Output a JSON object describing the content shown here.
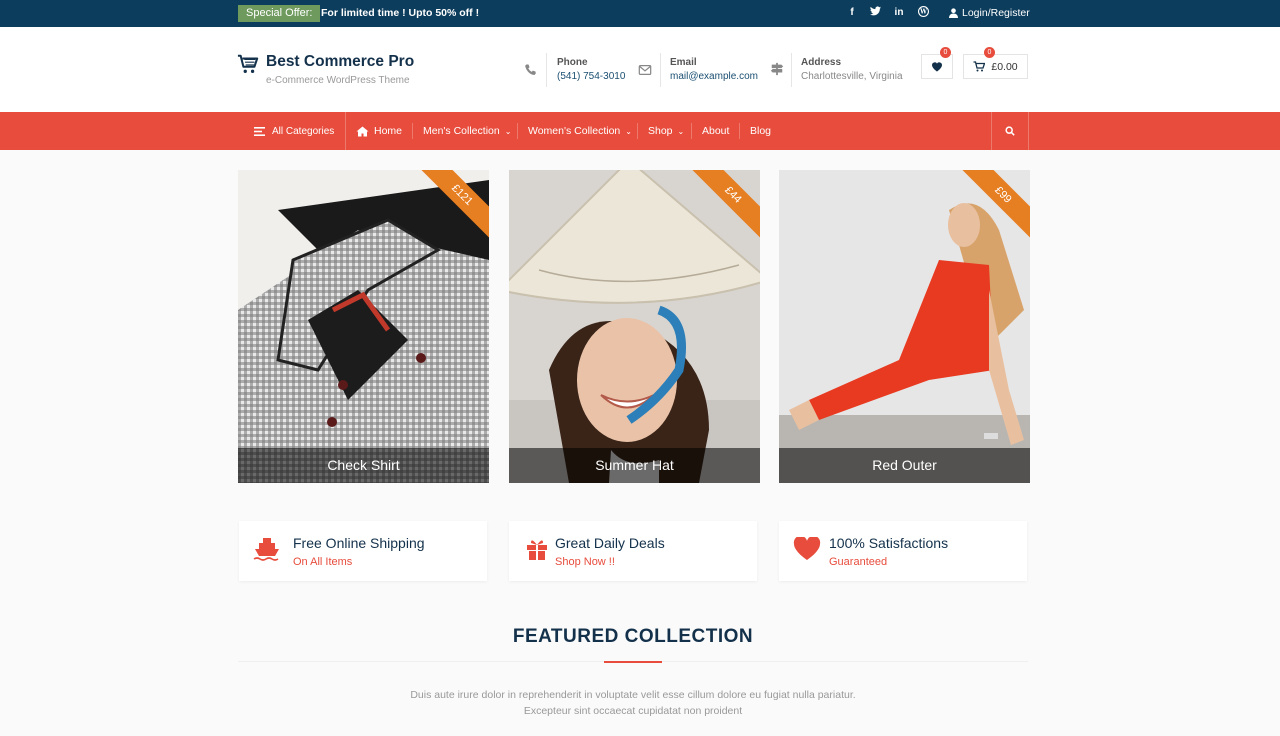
{
  "topbar": {
    "offer_badge": "Special Offer:",
    "offer_text": "For limited time ! Upto 50% off !",
    "social_icons": [
      "facebook-icon",
      "twitter-icon",
      "linkedin-icon",
      "wordpress-icon"
    ],
    "login": "Login/Register"
  },
  "header": {
    "site_title": "Best Commerce Pro",
    "tagline": "e-Commerce WordPress Theme",
    "phone": {
      "label": "Phone",
      "value": "(541) 754-3010"
    },
    "email": {
      "label": "Email",
      "value": "mail@example.com"
    },
    "address": {
      "label": "Address",
      "value": "Charlottesville, Virginia"
    },
    "wishlist_count": "0",
    "cart_count": "0",
    "cart_total": "£0.00"
  },
  "nav": {
    "categories": "All Categories",
    "items": [
      {
        "label": "Home"
      },
      {
        "label": "Men's Collection"
      },
      {
        "label": "Women's Collection"
      },
      {
        "label": "Shop"
      },
      {
        "label": "About"
      },
      {
        "label": "Blog"
      }
    ]
  },
  "products": [
    {
      "name": "Check Shirt",
      "price": "£121"
    },
    {
      "name": "Summer Hat",
      "price": "£44"
    },
    {
      "name": "Red Outer",
      "price": "£99"
    }
  ],
  "features": [
    {
      "title": "Free Online Shipping",
      "subtitle": "On All Items",
      "icon": "ship-icon"
    },
    {
      "title": "Great Daily Deals",
      "subtitle": "Shop Now !!",
      "icon": "gift-icon"
    },
    {
      "title": "100% Satisfactions",
      "subtitle": "Guaranteed",
      "icon": "heart-icon"
    }
  ],
  "featured": {
    "title": "FEATURED COLLECTION",
    "description": "Duis aute irure dolor in reprehenderit in voluptate velit esse cillum dolore eu fugiat nulla pariatur. Excepteur sint occaecat cupidatat non proident"
  },
  "colors": {
    "topbar": "#0d3d5c",
    "accent": "#e74c3c",
    "ribbon": "#e67e22",
    "navy": "#14314b"
  }
}
